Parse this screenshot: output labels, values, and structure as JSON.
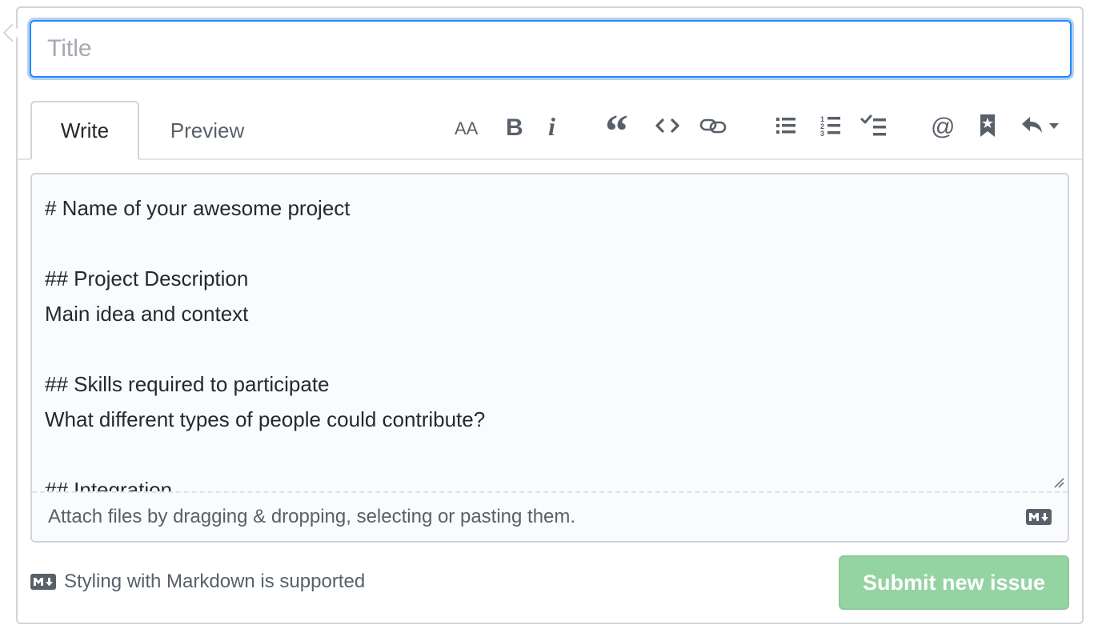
{
  "title_input": {
    "placeholder": "Title",
    "value": ""
  },
  "tabs": [
    {
      "label": "Write",
      "selected": true
    },
    {
      "label": "Preview",
      "selected": false
    }
  ],
  "toolbar": {
    "icons": [
      "text-size-icon",
      "bold-icon",
      "italic-icon",
      "quote-icon",
      "code-icon",
      "link-icon",
      "bulleted-list-icon",
      "numbered-list-icon",
      "task-list-icon",
      "mention-icon",
      "saved-reply-icon",
      "reply-icon"
    ],
    "heading_glyph": "AA",
    "bold_glyph": "B",
    "italic_glyph": "i",
    "quote_glyph": "“",
    "mention_glyph": "@"
  },
  "editor": {
    "lines": [
      "# Name of your awesome project",
      "",
      "## Project Description",
      "Main idea and context",
      "",
      "## Skills required to participate",
      "What different types of people could contribute?",
      "",
      "## Integration"
    ],
    "attach_text": "Attach files by dragging & dropping, selecting or pasting them."
  },
  "footer": {
    "markdown_note": "Styling with Markdown is supported",
    "submit_label": "Submit new issue"
  },
  "colors": {
    "focus_border": "#2188ff",
    "submit_disabled_bg": "#94d3a2",
    "muted_text": "#586069",
    "editor_bg": "#fafbfc"
  }
}
